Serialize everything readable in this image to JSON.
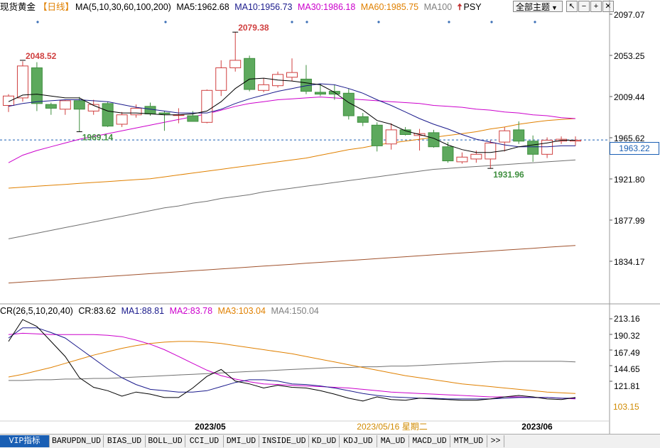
{
  "header": {
    "title": "现货黄金",
    "period": "【日线】",
    "ma_label": "MA(5,10,30,60,100,200)",
    "ma_values": [
      {
        "label": "MA5:1962.68",
        "color": "#000000"
      },
      {
        "label": "MA10:1956.73",
        "color": "#1a1a8c"
      },
      {
        "label": "MA30:1986.18",
        "color": "#cc00cc"
      },
      {
        "label": "MA60:1985.75",
        "color": "#e08000"
      },
      {
        "label": "MA100",
        "color": "#808080"
      }
    ],
    "psy_label": "PSY",
    "theme_select": "全部主题",
    "theme_arrow": "▼",
    "toolbar_icons": [
      "↖",
      "−",
      "+",
      "✕"
    ]
  },
  "cr_indicator": {
    "label": "CR(26,5,10,20,40)",
    "value": "CR:83.62",
    "mas": [
      {
        "label": "MA1:88.81",
        "color": "#1a1a8c"
      },
      {
        "label": "MA2:83.78",
        "color": "#cc00cc"
      },
      {
        "label": "MA3:103.04",
        "color": "#e08000"
      },
      {
        "label": "MA4:150.04",
        "color": "#808080"
      }
    ]
  },
  "price_axis_labels": [
    "2097.07",
    "2053.25",
    "2009.44",
    "1965.62",
    "1921.80",
    "1877.99",
    "1834.17"
  ],
  "current_price_tag": "1963.22",
  "cr_axis_labels": [
    "213.16",
    "190.32",
    "167.49",
    "144.65",
    "121.81"
  ],
  "current_cr_tag": "103.15",
  "annotations": {
    "high1": "2048.52",
    "high2": "2079.38",
    "low1": "1969.14",
    "low2": "1931.96"
  },
  "date_labels": {
    "may": "2023/05",
    "jun": "2023/06",
    "cursor": "2023/05/16 星期二"
  },
  "tabs": [
    "VIP指标",
    "BARUPDN_UD",
    "BIAS_UD",
    "BOLL_UD",
    "CCI_UD",
    "DMI_UD",
    "INSIDE_UD",
    "KD_UD",
    "KDJ_UD",
    "MA_UD",
    "MACD_UD",
    "MTM_UD",
    ">>"
  ],
  "chart_data": [
    {
      "type": "candlestick",
      "title": "现货黄金【日线】",
      "yaxis_ticks": [
        2097.07,
        2053.25,
        2009.44,
        1965.62,
        1921.8,
        1877.99,
        1834.17
      ],
      "ylim": [
        1802,
        2118
      ],
      "candles": [
        {
          "o": 2000,
          "h": 2012,
          "l": 1993,
          "c": 2010
        },
        {
          "o": 2008,
          "h": 2047,
          "l": 2004,
          "c": 2042
        },
        {
          "o": 2040,
          "h": 2046,
          "l": 1994,
          "c": 2002
        },
        {
          "o": 2001,
          "h": 2003,
          "l": 1990,
          "c": 1997
        },
        {
          "o": 1996,
          "h": 2006,
          "l": 1990,
          "c": 2005
        },
        {
          "o": 2005,
          "h": 2009,
          "l": 1972,
          "c": 1996
        },
        {
          "o": 1994,
          "h": 2006,
          "l": 1990,
          "c": 2001
        },
        {
          "o": 2002,
          "h": 2004,
          "l": 1977,
          "c": 1978
        },
        {
          "o": 1980,
          "h": 1993,
          "l": 1977,
          "c": 1990
        },
        {
          "o": 1990,
          "h": 2001,
          "l": 1987,
          "c": 1997
        },
        {
          "o": 1999,
          "h": 2003,
          "l": 1989,
          "c": 1991
        },
        {
          "o": 1992,
          "h": 1994,
          "l": 1973,
          "c": 1991
        },
        {
          "o": 1990,
          "h": 1997,
          "l": 1981,
          "c": 1990
        },
        {
          "o": 1989,
          "h": 1994,
          "l": 1983,
          "c": 1983
        },
        {
          "o": 1982,
          "h": 2017,
          "l": 1981,
          "c": 2016
        },
        {
          "o": 2016,
          "h": 2048,
          "l": 2010,
          "c": 2040
        },
        {
          "o": 2040,
          "h": 2078,
          "l": 2036,
          "c": 2048
        },
        {
          "o": 2050,
          "h": 2053,
          "l": 2015,
          "c": 2017
        },
        {
          "o": 2016,
          "h": 2029,
          "l": 2014,
          "c": 2022
        },
        {
          "o": 2021,
          "h": 2036,
          "l": 2019,
          "c": 2033
        },
        {
          "o": 2030,
          "h": 2050,
          "l": 2026,
          "c": 2035
        },
        {
          "o": 2028,
          "h": 2043,
          "l": 2012,
          "c": 2015
        },
        {
          "o": 2014,
          "h": 2023,
          "l": 2010,
          "c": 2012
        },
        {
          "o": 2015,
          "h": 2022,
          "l": 2006,
          "c": 2012
        },
        {
          "o": 2013,
          "h": 2018,
          "l": 1985,
          "c": 1989
        },
        {
          "o": 1988,
          "h": 1992,
          "l": 1978,
          "c": 1982
        },
        {
          "o": 1979,
          "h": 1982,
          "l": 1951,
          "c": 1957
        },
        {
          "o": 1959,
          "h": 1981,
          "l": 1953,
          "c": 1974
        },
        {
          "o": 1974,
          "h": 1977,
          "l": 1968,
          "c": 1969
        },
        {
          "o": 1968,
          "h": 1975,
          "l": 1952,
          "c": 1970
        },
        {
          "o": 1971,
          "h": 1974,
          "l": 1955,
          "c": 1956
        },
        {
          "o": 1956,
          "h": 1961,
          "l": 1939,
          "c": 1941
        },
        {
          "o": 1940,
          "h": 1950,
          "l": 1938,
          "c": 1945
        },
        {
          "o": 1943,
          "h": 1952,
          "l": 1939,
          "c": 1948
        },
        {
          "o": 1943,
          "h": 1963,
          "l": 1933,
          "c": 1960
        },
        {
          "o": 1961,
          "h": 1977,
          "l": 1951,
          "c": 1973
        },
        {
          "o": 1974,
          "h": 1983,
          "l": 1959,
          "c": 1962
        },
        {
          "o": 1962,
          "h": 1968,
          "l": 1940,
          "c": 1948
        },
        {
          "o": 1948,
          "h": 1966,
          "l": 1944,
          "c": 1963
        },
        {
          "o": 1962,
          "h": 1967,
          "l": 1959,
          "c": 1964
        },
        {
          "o": 1962,
          "h": 1967,
          "l": 1957,
          "c": 1963
        }
      ],
      "ma5": [
        2004,
        2011,
        2012,
        2010,
        2008,
        2008,
        2000,
        1994,
        1992,
        1992,
        1991,
        1990,
        1990,
        1991,
        1994,
        2004,
        2018,
        2028,
        2029,
        2027,
        2026,
        2024,
        2022,
        2014,
        2003,
        1995,
        1984,
        1980,
        1973,
        1969,
        1965,
        1958,
        1953,
        1950,
        1950,
        1952,
        1956,
        1958,
        1960,
        1963,
        1963
      ],
      "ma10": [
        1999,
        2002,
        2004,
        2005,
        2006,
        2006,
        2005,
        2004,
        2001,
        1998,
        1996,
        1994,
        1992,
        1992,
        1992,
        1996,
        2002,
        2007,
        2011,
        2015,
        2018,
        2021,
        2023,
        2022,
        2018,
        2013,
        2006,
        2000,
        1993,
        1986,
        1980,
        1975,
        1969,
        1964,
        1961,
        1958,
        1956,
        1956,
        1956,
        1957,
        1957
      ],
      "ma30": [
        1939,
        1947,
        1952,
        1956,
        1960,
        1964,
        1967,
        1970,
        1973,
        1976,
        1979,
        1982,
        1985,
        1988,
        1991,
        1995,
        1999,
        2002,
        2004,
        2006,
        2007,
        2008,
        2009,
        2008,
        2007,
        2006,
        2005,
        2004,
        2003,
        2002,
        2000,
        1999,
        1998,
        1996,
        1995,
        1993,
        1992,
        1990,
        1989,
        1987,
        1986
      ],
      "ma60": [
        1912,
        1913,
        1914,
        1915,
        1916,
        1917,
        1918,
        1919,
        1920,
        1921,
        1922,
        1924,
        1926,
        1928,
        1930,
        1932,
        1934,
        1936,
        1938,
        1940,
        1942,
        1944,
        1947,
        1950,
        1953,
        1955,
        1958,
        1960,
        1962,
        1964,
        1966,
        1968,
        1970,
        1972,
        1975,
        1977,
        1980,
        1982,
        1984,
        1985,
        1986
      ],
      "ma100": [
        1858,
        1861,
        1864,
        1867,
        1870,
        1873,
        1876,
        1879,
        1882,
        1885,
        1888,
        1891,
        1893,
        1896,
        1898,
        1901,
        1903,
        1905,
        1908,
        1910,
        1912,
        1914,
        1916,
        1918,
        1920,
        1922,
        1924,
        1926,
        1928,
        1930,
        1932,
        1933,
        1934,
        1935,
        1936,
        1937,
        1938,
        1939,
        1940,
        1941,
        1942
      ],
      "ma200": [
        1811,
        1812,
        1813,
        1814,
        1815,
        1816,
        1817,
        1818,
        1819,
        1820,
        1821,
        1822,
        1823,
        1824,
        1825,
        1826,
        1827,
        1828,
        1829,
        1830,
        1831,
        1832,
        1833,
        1834,
        1835,
        1836,
        1837,
        1838,
        1839,
        1840,
        1841,
        1842,
        1843,
        1844,
        1845,
        1846,
        1847,
        1848,
        1849,
        1850,
        1851
      ],
      "current_price": 1963.22
    },
    {
      "type": "line",
      "title": "CR(26,5,10,20,40)",
      "yaxis_ticks": [
        213.16,
        190.32,
        167.49,
        144.65,
        121.81
      ],
      "ylim": [
        93,
        220
      ],
      "cr": [
        180,
        212,
        202,
        180,
        158,
        127,
        113,
        108,
        100,
        106,
        103,
        98,
        98,
        112,
        129,
        139,
        122,
        118,
        112,
        116,
        113,
        112,
        108,
        103,
        97,
        93,
        99,
        95,
        94,
        97,
        96,
        95,
        94,
        94,
        96,
        99,
        101,
        99,
        96,
        95,
        98
      ],
      "ma1": [
        185,
        200,
        200,
        193,
        185,
        170,
        155,
        140,
        127,
        117,
        110,
        108,
        106,
        106,
        108,
        114,
        120,
        124,
        124,
        122,
        118,
        117,
        115,
        112,
        108,
        104,
        101,
        99,
        98,
        97,
        97,
        96,
        96,
        96,
        96,
        97,
        98,
        98,
        98,
        97,
        97
      ],
      "ma2": [
        190,
        192,
        191,
        190,
        190,
        190,
        190,
        189,
        187,
        182,
        176,
        168,
        158,
        148,
        138,
        130,
        125,
        121,
        118,
        117,
        116,
        115,
        114,
        113,
        112,
        110,
        108,
        106,
        105,
        104,
        103,
        102,
        101,
        100,
        99,
        99,
        99,
        98,
        98,
        97,
        96
      ],
      "ma3": [
        128,
        132,
        137,
        142,
        148,
        154,
        160,
        165,
        170,
        174,
        177,
        179,
        180,
        180,
        179,
        177,
        174,
        171,
        168,
        165,
        162,
        158,
        154,
        150,
        146,
        142,
        138,
        134,
        130,
        127,
        124,
        121,
        118,
        116,
        114,
        112,
        110,
        108,
        106,
        105,
        104
      ],
      "ma4": [
        123,
        123,
        124,
        124,
        125,
        125,
        126,
        126,
        127,
        128,
        129,
        130,
        131,
        132,
        133,
        134,
        135,
        136,
        137,
        138,
        139,
        140,
        141,
        142,
        142,
        143,
        143,
        144,
        144,
        145,
        146,
        147,
        148,
        149,
        150,
        151,
        151,
        151,
        151,
        151,
        150
      ],
      "current_value": 103.15
    }
  ]
}
